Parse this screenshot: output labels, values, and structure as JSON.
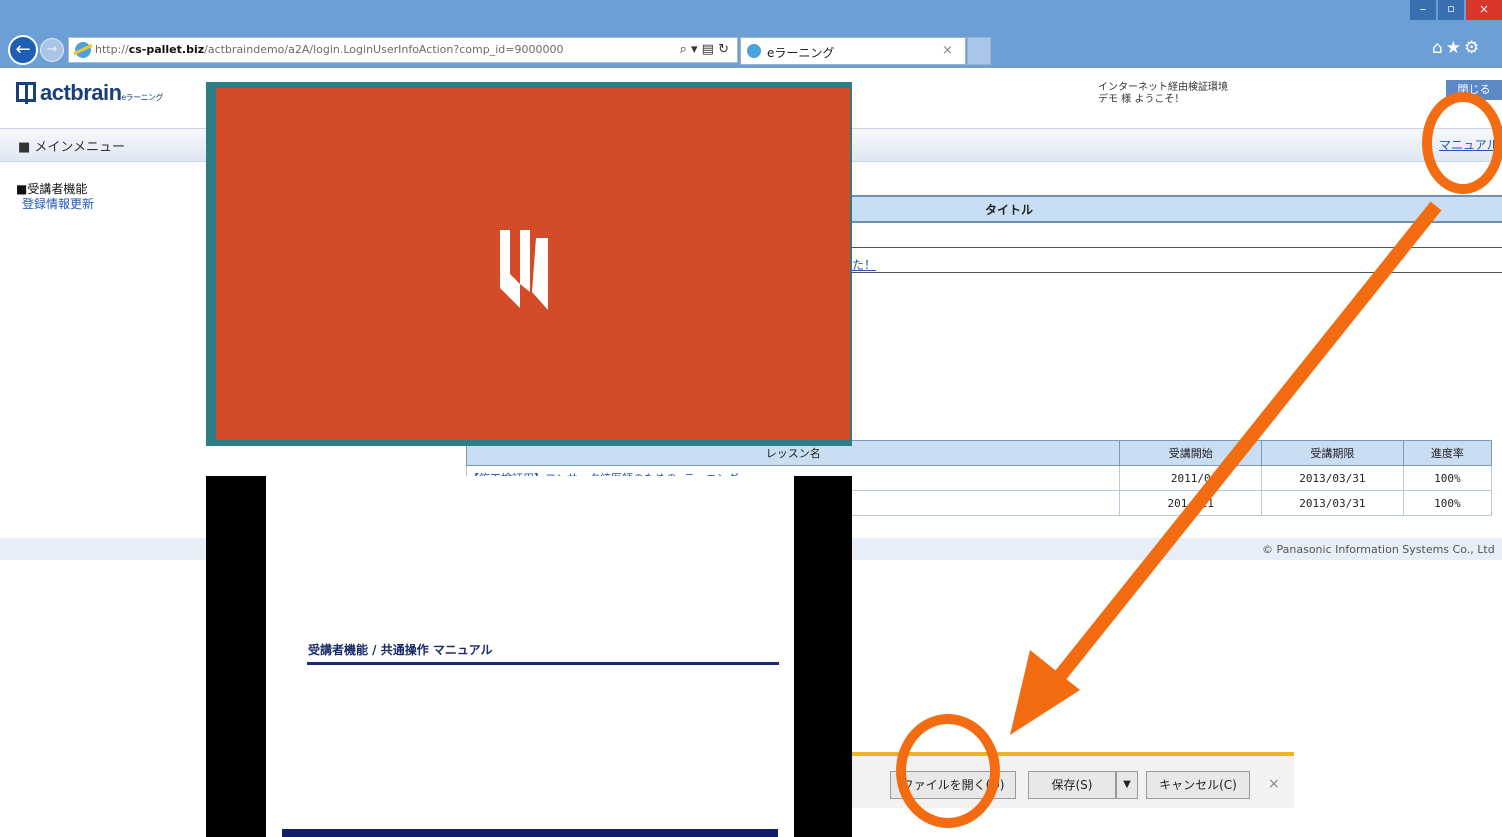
{
  "browser": {
    "url_prefix": "http://",
    "url_host": "cs-pallet.biz",
    "url_rest": "/actbraindemo/a2A/login.LoginUserInfoAction?comp_id=9000000",
    "url_tools": "⌕ ▾ ▤ ↻",
    "back_icon": "←",
    "forward_icon": "→",
    "tab_title": "eラーニング",
    "tab_close": "×",
    "minimize_icon": "–",
    "maximize_icon": "▫",
    "close_icon": "×",
    "toolbar_icons": "⌂★⚙"
  },
  "header": {
    "logo_text": "actbrain",
    "logo_sub": "eラーニング",
    "env_line1": "インターネット経由検証環境",
    "env_line2": "デモ 様 ようこそ！",
    "close_button": "閉じる"
  },
  "menubar": {
    "title": "■ メインメニュー",
    "manual_link": "マニュアル"
  },
  "sidebar": {
    "section_title": "■受講者機能",
    "update_link": "登録情報更新"
  },
  "info_table": {
    "header": "タイトル",
    "row_link": "た！"
  },
  "lesson_table": {
    "headers": [
      "レッスン名",
      "受講開始",
      "受講期限",
      "進度率"
    ],
    "rows": [
      {
        "name": "【施工検証用】コンサーク統医師のためのeラーニング",
        "start": "2011/0",
        "end": "2013/03/31",
        "progress": "100%"
      },
      {
        "name": "",
        "start": "201  /21",
        "end": "2013/03/31",
        "progress": "100%"
      }
    ]
  },
  "footer": {
    "copyright": "© Panasonic Information Systems Co., Ltd"
  },
  "pdf": {
    "title": "受講者機能 / 共通操作 マニュアル"
  },
  "download_bar": {
    "open": "ファイルを開く(O)",
    "save": "保存(S)",
    "save_arrow": "▼",
    "cancel": "キャンセル(C)",
    "close": "×"
  },
  "colors": {
    "annotation_orange": "#f36c12",
    "splash_red": "#d24a26",
    "link_blue": "#2255bb"
  }
}
